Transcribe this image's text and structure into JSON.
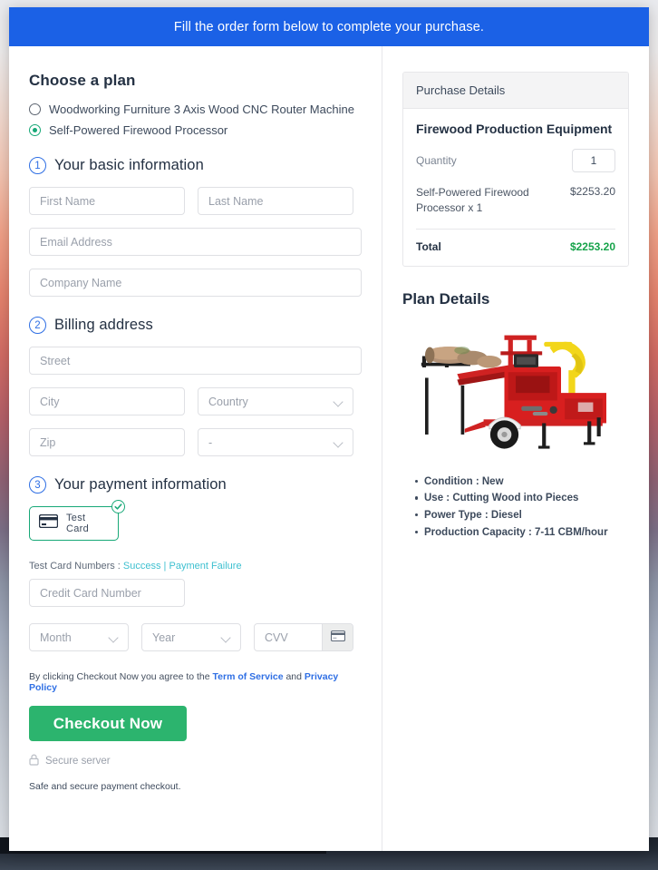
{
  "banner": {
    "message": "Fill the order form below to complete your purchase."
  },
  "plans": {
    "heading": "Choose a plan",
    "options": [
      {
        "label": "Woodworking Furniture 3 Axis Wood CNC Router Machine",
        "selected": false
      },
      {
        "label": "Self-Powered Firewood Processor",
        "selected": true
      }
    ]
  },
  "steps": [
    {
      "number": "1",
      "label": "Your basic information"
    },
    {
      "number": "2",
      "label": "Billing address"
    },
    {
      "number": "3",
      "label": "Your payment information"
    }
  ],
  "basic_info": {
    "first_name_placeholder": "First Name",
    "last_name_placeholder": "Last Name",
    "email_placeholder": "Email Address",
    "company_placeholder": "Company Name",
    "first_name_value": "",
    "last_name_value": "",
    "email_value": "",
    "company_value": ""
  },
  "billing": {
    "street_placeholder": "Street",
    "city_placeholder": "City",
    "country_placeholder": "Country",
    "zip_placeholder": "Zip",
    "state_placeholder": "-",
    "street_value": "",
    "city_value": "",
    "country_value": "Country",
    "zip_value": "",
    "state_value": "-"
  },
  "payment": {
    "tile_label": "Test Card",
    "tile_selected": true,
    "test_numbers_prefix": "Test Card Numbers : ",
    "success_link": "Success",
    "separator": " | ",
    "failure_link": "Payment Failure",
    "card_number_placeholder": "Credit Card Number",
    "card_number_value": "",
    "month_placeholder": "Month",
    "year_placeholder": "Year",
    "cvv_placeholder": "CVV",
    "month_value": "Month",
    "year_value": "Year",
    "cvv_value": ""
  },
  "agreement": {
    "prefix": "By clicking Checkout Now you agree to the ",
    "terms_link": "Term of Service",
    "middle": " and ",
    "privacy_link": "Privacy Policy"
  },
  "checkout": {
    "button_label": "Checkout Now",
    "secure_label": "Secure server",
    "safe_note": "Safe and secure payment checkout."
  },
  "purchase_details": {
    "header": "Purchase Details",
    "product_title": "Firewood Production Equipment",
    "quantity_label": "Quantity",
    "quantity_value": "1",
    "line_item_name": "Self-Powered Firewood Processor x 1",
    "line_item_price": "$2253.20",
    "total_label": "Total",
    "total_value": "$2253.20"
  },
  "plan_details": {
    "heading": "Plan Details",
    "image_alt": "Red self-powered firewood processor machine on trailer with logs",
    "features": [
      "Condition : New",
      "Use : Cutting Wood into Pieces",
      "Power Type : Diesel",
      "Production Capacity : 7-11 CBM/hour"
    ]
  },
  "colors": {
    "banner_blue": "#1b61e6",
    "accent_green": "#17a877",
    "checkout_green": "#2cb46e",
    "total_green": "#16a34a",
    "link_blue": "#2f6fe4",
    "link_teal": "#3ec0d0",
    "heading_navy": "#243143"
  }
}
